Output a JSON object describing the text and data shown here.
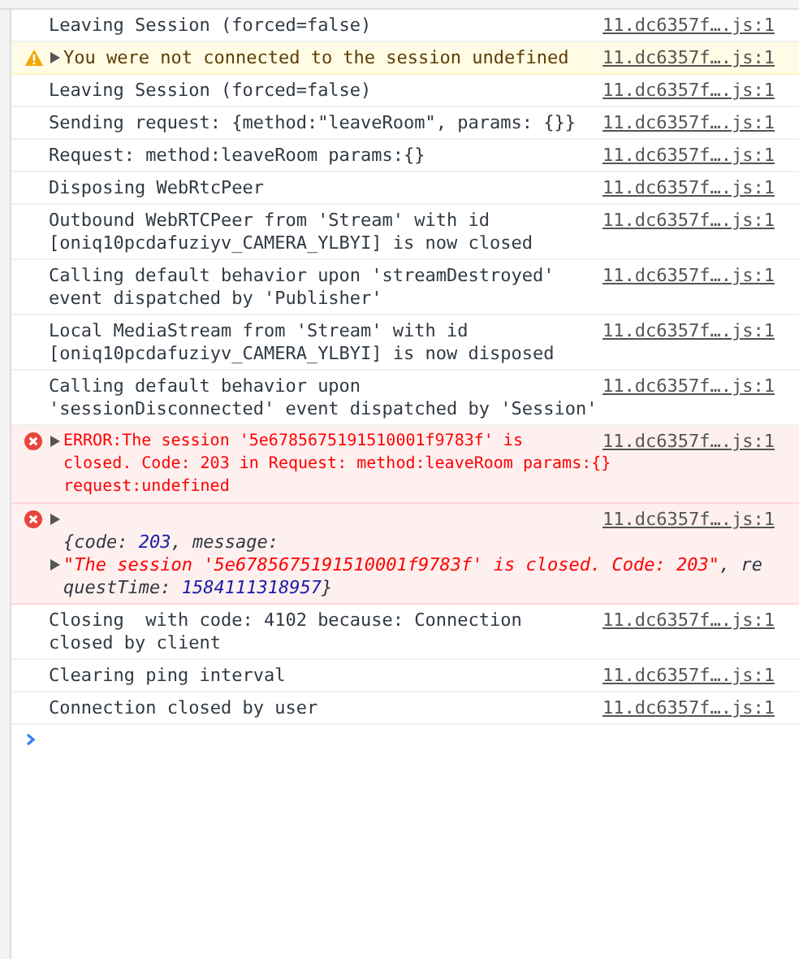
{
  "messages": [
    {
      "kind": "log",
      "lines": [
        "Leaving Session (forced=false)"
      ],
      "source": "11.dc6357f….js:1"
    },
    {
      "kind": "warning",
      "expanded": false,
      "lines": [
        "You were not connected to the session undefined"
      ],
      "source": "11.dc6357f….js:1"
    },
    {
      "kind": "log",
      "lines": [
        "Leaving Session (forced=false)"
      ],
      "source": "11.dc6357f….js:1"
    },
    {
      "kind": "log",
      "lines": [
        "Sending request: {method:\"leaveRoom\", params: {}}"
      ],
      "source": "11.dc6357f….js:1"
    },
    {
      "kind": "log",
      "lines": [
        "Request: method:leaveRoom params:{}"
      ],
      "source": "11.dc6357f….js:1"
    },
    {
      "kind": "log",
      "lines": [
        "Disposing WebRtcPeer"
      ],
      "source": "11.dc6357f….js:1"
    },
    {
      "kind": "log",
      "lines": [
        "Outbound WebRTCPeer from 'Stream' with id",
        "[oniq10pcdafuziyv_CAMERA_YLBYI] is now closed"
      ],
      "source": "11.dc6357f….js:1"
    },
    {
      "kind": "log",
      "lines": [
        "Calling default behavior upon 'streamDestroyed'",
        "event dispatched by 'Publisher'"
      ],
      "source": "11.dc6357f….js:1"
    },
    {
      "kind": "log",
      "lines": [
        "Local MediaStream from 'Stream' with id",
        "[oniq10pcdafuziyv_CAMERA_YLBYI] is now disposed"
      ],
      "source": "11.dc6357f….js:1"
    },
    {
      "kind": "log",
      "lines": [
        "Calling default behavior upon",
        "'sessionDisconnected' event dispatched by 'Session'"
      ],
      "source": "11.dc6357f….js:1"
    },
    {
      "kind": "error",
      "expanded": false,
      "lines": [
        "ERROR:The session '5e6785675191510001f9783f' is",
        "closed. Code: 203 in Request: method:leaveRoom params:{}",
        "request:undefined"
      ],
      "source": "11.dc6357f….js:1"
    },
    {
      "kind": "error-object",
      "expanded": false,
      "source": "11.dc6357f….js:1",
      "object_lines": [
        {
          "caret": false,
          "segments": [
            {
              "kind": "key",
              "text": "{code: "
            },
            {
              "kind": "number",
              "text": "203"
            },
            {
              "kind": "key",
              "text": ", message:"
            }
          ]
        },
        {
          "caret": true,
          "segments": [
            {
              "kind": "string",
              "text": "\"The session '5e6785675191510001f9783f' is closed. Code: 203\""
            },
            {
              "kind": "key",
              "text": ", re"
            }
          ]
        },
        {
          "caret": false,
          "segments": [
            {
              "kind": "key",
              "text": "questTime: "
            },
            {
              "kind": "number",
              "text": "1584111318957"
            },
            {
              "kind": "key",
              "text": "}"
            }
          ]
        }
      ]
    },
    {
      "kind": "log",
      "lines": [
        "Closing  with code: 4102 because: Connection",
        "closed by client"
      ],
      "source": "11.dc6357f….js:1"
    },
    {
      "kind": "log",
      "lines": [
        "Clearing ping interval"
      ],
      "source": "11.dc6357f….js:1"
    },
    {
      "kind": "log",
      "lines": [
        "Connection closed by user"
      ],
      "source": "11.dc6357f….js:1"
    }
  ]
}
